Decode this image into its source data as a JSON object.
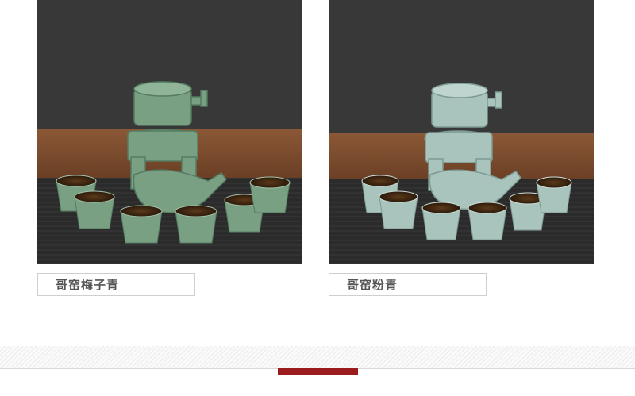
{
  "products": [
    {
      "caption": "哥窑梅子青",
      "colors": {
        "glaze": "#79a083",
        "glaze_dark": "#557b61",
        "glaze_light": "#a6c4ad"
      }
    },
    {
      "caption": "哥窑粉青",
      "colors": {
        "glaze": "#a9c4bd",
        "glaze_dark": "#7d9a93",
        "glaze_light": "#cfe0db"
      }
    }
  ],
  "colors": {
    "wall": "#353535",
    "table_wood": "#7a4a2c",
    "mat": "#2b2b2b",
    "accent": "#9b1c1c"
  }
}
